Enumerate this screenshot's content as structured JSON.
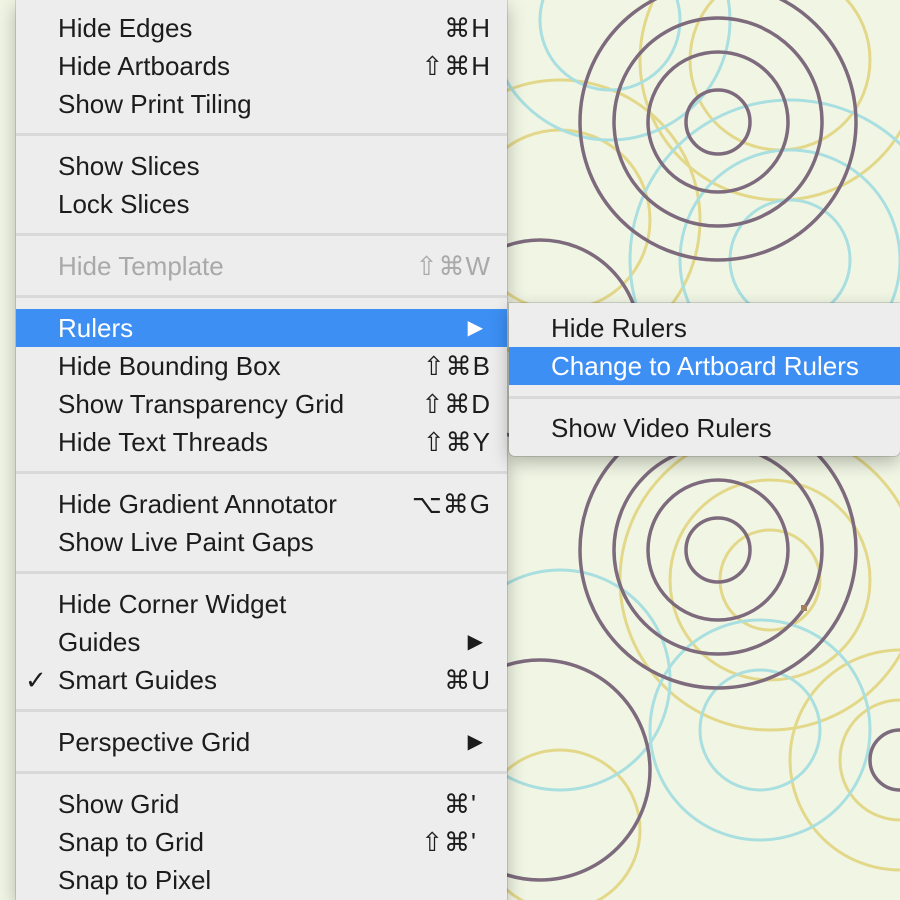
{
  "main_menu": {
    "hide_edges": {
      "label": "Hide Edges",
      "shortcut": "⌘H"
    },
    "hide_artboards": {
      "label": "Hide Artboards",
      "shortcut": "⇧⌘H"
    },
    "show_print_tiling": {
      "label": "Show Print Tiling",
      "shortcut": ""
    },
    "show_slices": {
      "label": "Show Slices",
      "shortcut": ""
    },
    "lock_slices": {
      "label": "Lock Slices",
      "shortcut": ""
    },
    "hide_template": {
      "label": "Hide Template",
      "shortcut": "⇧⌘W",
      "disabled": true
    },
    "rulers": {
      "label": "Rulers",
      "arrow": "▶",
      "highlighted": true
    },
    "hide_bounding_box": {
      "label": "Hide Bounding Box",
      "shortcut": "⇧⌘B"
    },
    "show_transparency_grid": {
      "label": "Show Transparency Grid",
      "shortcut": "⇧⌘D"
    },
    "hide_text_threads": {
      "label": "Hide Text Threads",
      "shortcut": "⇧⌘Y"
    },
    "hide_gradient_annotator": {
      "label": "Hide Gradient Annotator",
      "shortcut": "⌥⌘G"
    },
    "show_live_paint_gaps": {
      "label": "Show Live Paint Gaps",
      "shortcut": ""
    },
    "hide_corner_widget": {
      "label": "Hide Corner Widget",
      "shortcut": ""
    },
    "guides": {
      "label": "Guides",
      "arrow": "▶"
    },
    "smart_guides": {
      "label": "Smart Guides",
      "shortcut": "⌘U",
      "check": "✓"
    },
    "perspective_grid": {
      "label": "Perspective Grid",
      "arrow": "▶"
    },
    "show_grid": {
      "label": "Show Grid",
      "shortcut": "⌘'"
    },
    "snap_to_grid": {
      "label": "Snap to Grid",
      "shortcut": "⇧⌘'"
    },
    "snap_to_pixel": {
      "label": "Snap to Pixel",
      "shortcut": ""
    }
  },
  "submenu": {
    "hide_rulers": {
      "label": "Hide Rulers"
    },
    "change_to_artboard_rulers": {
      "label": "Change to Artboard Rulers",
      "highlighted": true
    },
    "show_video_rulers": {
      "label": "Show Video Rulers"
    }
  },
  "colors": {
    "highlight": "#3d8ff4",
    "menu_bg": "#ededed",
    "canvas_bg": "#f1f6e4",
    "ring_purple": "#7d6b7d",
    "ring_yellow": "#e3d88a",
    "ring_cyan": "#a9dfe0"
  }
}
